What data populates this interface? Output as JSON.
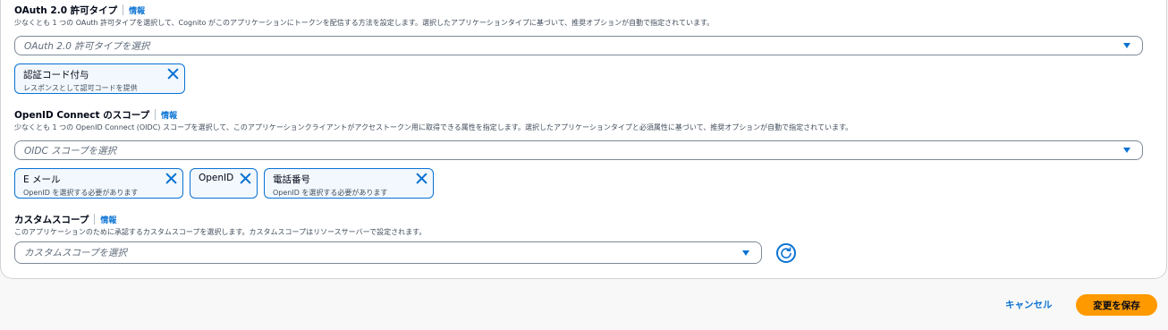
{
  "oauth": {
    "label": "OAuth 2.0 許可タイプ",
    "info": "情報",
    "description": "少なくとも 1 つの OAuth 許可タイプを選択して、Cognito がこのアプリケーションにトークンを配信する方法を設定します。選択したアプリケーションタイプに基づいて、推奨オプションが自動で指定されています。",
    "placeholder": "OAuth 2.0 許可タイプを選択",
    "tokens": [
      {
        "label": "認証コード付与",
        "sub": "レスポンスとして認可コードを提供"
      }
    ]
  },
  "oidc": {
    "label": "OpenID Connect のスコープ",
    "info": "情報",
    "description": "少なくとも 1 つの OpenID Connect (OIDC) スコープを選択して、このアプリケーションクライアントがアクセストークン用に取得できる属性を指定します。選択したアプリケーションタイプと必須属性に基づいて、推奨オプションが自動で指定されています。",
    "placeholder": "OIDC スコープを選択",
    "tokens": [
      {
        "label": "E メール",
        "sub": "OpenID を選択する必要があります"
      },
      {
        "label": "OpenID",
        "sub": ""
      },
      {
        "label": "電話番号",
        "sub": "OpenID を選択する必要があります"
      }
    ]
  },
  "custom": {
    "label": "カスタムスコープ",
    "info": "情報",
    "description": "このアプリケーションのために承認するカスタムスコープを選択します。カスタムスコープはリソースサーバーで設定されます。",
    "placeholder": "カスタムスコープを選択"
  },
  "footer": {
    "cancel_label": "キャンセル",
    "save_label": "変更を保存"
  },
  "colors": {
    "accent": "#0972d3",
    "primary_button": "#ff9900"
  },
  "icons": {
    "dismiss": "close-icon",
    "dropdown": "caret-down-icon",
    "refresh": "refresh-icon"
  }
}
